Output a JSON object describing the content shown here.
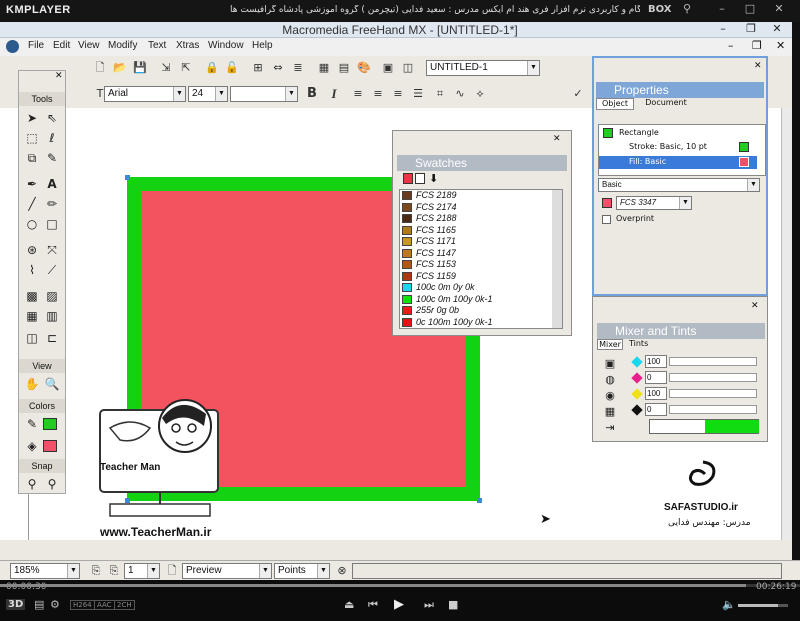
{
  "player": {
    "logo": "KMPLAYER",
    "title": "مجموعه آموزشی جامع ، گام به گام و کاربردی نرم افزار فری هند ام ایکس   مدرس : سعید فدایی (تیچرمن ) گروه آموزشی پادشاه گرافیست ها",
    "box_label": "BOX",
    "time_current": "00:00:30",
    "time_total": "00:26:19",
    "badges": [
      "H264",
      "AAC",
      "2CH"
    ],
    "mode_3d": "3D"
  },
  "window": {
    "title": "Macromedia FreeHand MX - [UNTITLED-1*]"
  },
  "menu": [
    "File",
    "Edit",
    "View",
    "Modify",
    "Text",
    "Xtras",
    "Window",
    "Help"
  ],
  "toolbar": {
    "document_select": "UNTITLED-1",
    "font_name": "Arial",
    "font_size": "24"
  },
  "tools_panel": {
    "title": "Tools",
    "sections": [
      "View",
      "Colors",
      "Snap"
    ]
  },
  "swatches": {
    "title": "Swatches",
    "items": [
      {
        "name": "FCS 2189",
        "color": "#6b3a22"
      },
      {
        "name": "FCS 2174",
        "color": "#7a4a1e"
      },
      {
        "name": "FCS 2188",
        "color": "#4a2a14"
      },
      {
        "name": "FCS 1165",
        "color": "#b07a16"
      },
      {
        "name": "FCS 1171",
        "color": "#c89a1a"
      },
      {
        "name": "FCS 1147",
        "color": "#c0781a"
      },
      {
        "name": "FCS 1153",
        "color": "#b25814"
      },
      {
        "name": "FCS 1159",
        "color": "#a83c10"
      },
      {
        "name": "100c 0m 0y 0k",
        "color": "#18d8f0"
      },
      {
        "name": "100c 0m 100y 0k-1",
        "color": "#10e010"
      },
      {
        "name": "255r 0g 0b",
        "color": "#ee1818"
      },
      {
        "name": "0c 100m 100y 0k-1",
        "color": "#e81010"
      }
    ]
  },
  "properties": {
    "title": "Properties",
    "tabs": [
      "Object",
      "Document"
    ],
    "list": [
      "Rectangle",
      "Stroke: Basic, 10 pt",
      "Fill: Basic"
    ],
    "fill_type": "Basic",
    "color_name": "FCS 3347",
    "overprint": "Overprint",
    "colors": {
      "stroke": "#22cc22",
      "fill": "#f0506a"
    }
  },
  "mixer": {
    "title": "Mixer and Tints",
    "tabs": [
      "Mixer",
      "Tints"
    ],
    "values": [
      "100",
      "0",
      "100",
      "0"
    ],
    "result_color": "#10dd10"
  },
  "canvas": {
    "rect_fill": "#f2535f",
    "rect_stroke": "#12d212"
  },
  "watermark": {
    "url": "www.TeacherMan.ir",
    "name": "Teacher Man",
    "studio": "SAFASTUDIO.ir",
    "teacher": "مدرس: مهندس فدایی"
  },
  "status": {
    "zoom": "185%",
    "page": "1",
    "view_mode": "Preview",
    "units": "Points"
  }
}
